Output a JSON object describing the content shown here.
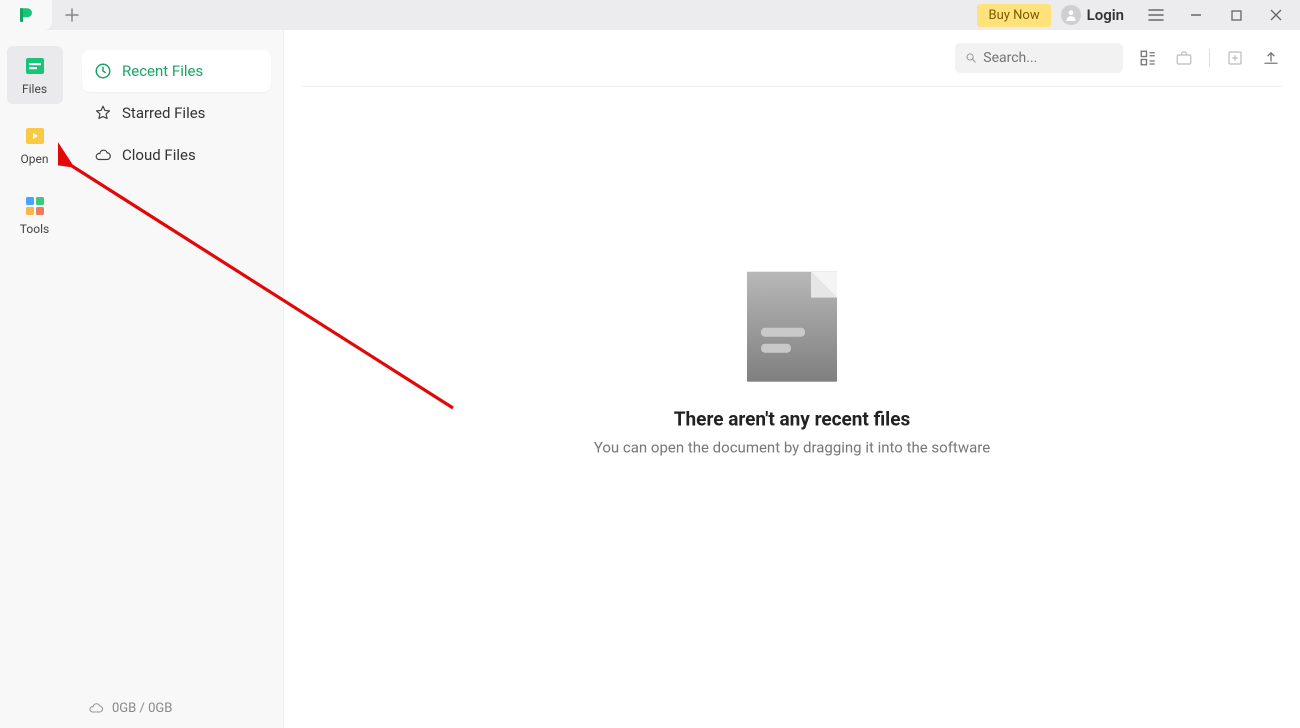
{
  "titlebar": {
    "buy_now": "Buy Now",
    "login": "Login"
  },
  "rail": {
    "items": [
      {
        "label": "Files"
      },
      {
        "label": "Open"
      },
      {
        "label": "Tools"
      }
    ]
  },
  "side": {
    "items": [
      {
        "label": "Recent Files"
      },
      {
        "label": "Starred Files"
      },
      {
        "label": "Cloud Files"
      }
    ]
  },
  "storage": {
    "text": "0GB / 0GB"
  },
  "toolbar": {
    "search_placeholder": "Search..."
  },
  "empty": {
    "title": "There aren't any recent files",
    "subtitle": "You can open the document by dragging it into the software"
  },
  "colors": {
    "accent": "#18a566",
    "buy_bg": "#ffe27a"
  }
}
